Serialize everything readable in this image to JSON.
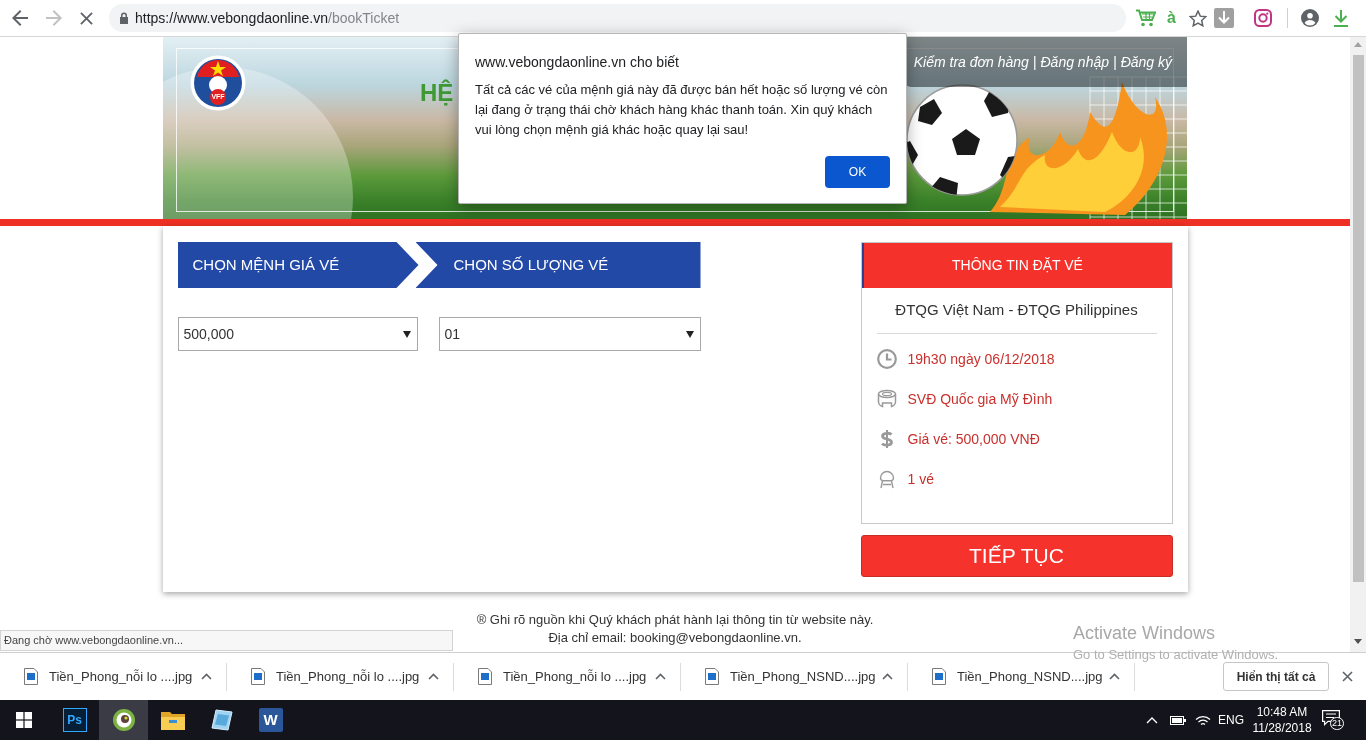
{
  "browser": {
    "navigation": {
      "forward_disabled": true,
      "loading": true
    },
    "url": {
      "origin": "https://www.vebongdaonline.vn",
      "path": "/bookTicket"
    },
    "extension_glyph": "à"
  },
  "banner": {
    "logo_text": "VFF",
    "title": "HỆ",
    "header_links": [
      "Kiểm tra đơn hàng",
      "Đăng nhập",
      "Đăng ký"
    ],
    "link_separators": [
      "|",
      "|"
    ]
  },
  "steps": [
    {
      "label": "CHỌN MỆNH GIÁ VÉ"
    },
    {
      "label": "CHỌN SỐ LƯỢNG VÉ"
    }
  ],
  "selects": [
    {
      "value": "500,000"
    },
    {
      "value": "01"
    }
  ],
  "booking_info": {
    "title": "THÔNG TIN ĐẶT VÉ",
    "match": "ĐTQG Việt Nam - ĐTQG Philippines",
    "details": [
      {
        "kind": "time",
        "text": "19h30 ngày 06/12/2018"
      },
      {
        "kind": "venue",
        "text": "SVĐ Quốc gia Mỹ Đình"
      },
      {
        "kind": "price",
        "text": "Giá vé: 500,000 VNĐ"
      },
      {
        "kind": "quantity",
        "text": "1 vé"
      }
    ]
  },
  "continue_button": "TIẾP TỤC",
  "footer": [
    "® Ghi rõ nguồn khi Quý khách phát hành lại thông tin từ website này.",
    "Địa chỉ email: booking@vebongdaonline.vn."
  ],
  "status_bubble": "Đang chờ www.vebongdaonline.vn...",
  "dialog": {
    "title": "www.vebongdaonline.vn cho biết",
    "message": "Tất cả các vé của mệnh giá này đã được bán hết hoặc số lượng vé còn lại đang ở trạng thái chờ khách hàng khác thanh toán. Xin quý khách vui lòng chọn mệnh giá khác hoặc quay lại sau!",
    "button": "OK"
  },
  "downloads_bar": {
    "items": [
      {
        "name": "Tiền_Phong_nỗi lo ....jpg"
      },
      {
        "name": "Tiền_Phong_nỗi lo ....jpg"
      },
      {
        "name": "Tiền_Phong_nỗi lo ....jpg"
      },
      {
        "name": "Tiền_Phong_NSND....jpg"
      },
      {
        "name": "Tiền_Phong_NSND....jpg"
      }
    ],
    "show_all": "Hiển thị tất cả"
  },
  "windows_notice": {
    "title": "Activate Windows",
    "hint": "Go to Settings to activate Windows."
  },
  "taskbar": {
    "apps": [
      {
        "kind": "ps_tile",
        "label": "Ps",
        "selected": false
      },
      {
        "kind": "ring",
        "selected": true
      },
      {
        "kind": "folder",
        "selected": false
      },
      {
        "kind": "panel",
        "selected": false
      },
      {
        "kind": "w_tile",
        "label": "W",
        "selected": false
      }
    ],
    "language": "ENG",
    "time": "10:48 AM",
    "date": "11/28/2018",
    "notification_count": "21"
  }
}
